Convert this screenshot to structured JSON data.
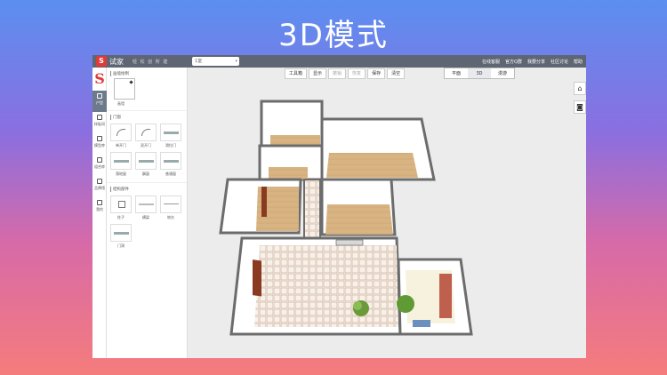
{
  "promo_title": "3D模式",
  "topbar": {
    "brand": "试家",
    "slogan": "轻 松 创 所 建",
    "project_value": "1室",
    "links": [
      "在线客服",
      "官方Q群",
      "我要分享",
      "社区讨论",
      "帮助"
    ]
  },
  "iconbar": {
    "items": [
      "户型",
      "样板间",
      "模型库",
      "组合库",
      "品牌馆",
      "我的"
    ]
  },
  "panel": {
    "draw_section": "画墙绘制",
    "draw_item": "画墙",
    "door_section": "门窗",
    "doors": [
      "单开门",
      "双开门",
      "滑拉门",
      "落地窗",
      "飘窗",
      "普通窗"
    ],
    "structure_section": "结构部件",
    "structures": [
      "柱子",
      "横梁",
      "地台",
      "门洞"
    ]
  },
  "toolbar": {
    "buttons": [
      "工具箱",
      "显示",
      "撤销",
      "恢复",
      "保存",
      "清空"
    ]
  },
  "view_tabs": [
    "平面",
    "3D",
    "漫游"
  ],
  "active_view": "3D",
  "icons": [
    "home-icon",
    "camera-icon"
  ]
}
